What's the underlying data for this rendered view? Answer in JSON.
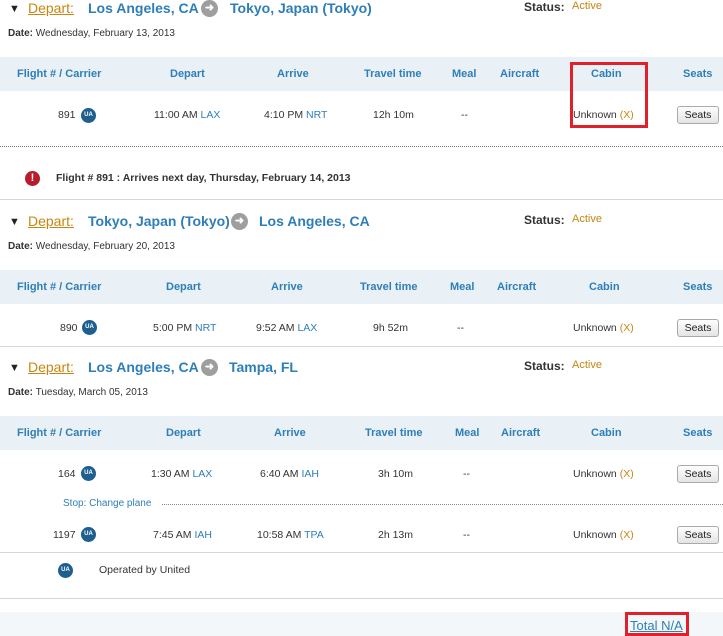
{
  "columns": [
    "Flight # / Carrier",
    "Depart",
    "Arrive",
    "Travel time",
    "Meal",
    "Aircraft",
    "Cabin",
    "Seats"
  ],
  "status_label": "Status:",
  "date_label": "Date:",
  "seats_label": "Seats",
  "trips": [
    {
      "toggle": "▼",
      "depart_label": "Depart:",
      "from": "Los Angeles, CA",
      "to": "Tokyo, Japan (Tokyo)",
      "status": "Active",
      "date": "Wednesday, February 13, 2013",
      "flights": [
        {
          "number": "891",
          "carrier": "UA",
          "depart_time": "11:00 AM",
          "depart_code": "LAX",
          "arrive_time": "4:10 PM",
          "arrive_code": "NRT",
          "travel_time": "12h 10m",
          "meal": "--",
          "aircraft": "",
          "cabin": "Unknown",
          "cabin_x": "(X)"
        }
      ],
      "alert": "Flight # 891 : Arrives next day, Thursday, February 14, 2013"
    },
    {
      "toggle": "▼",
      "depart_label": "Depart:",
      "from": "Tokyo, Japan (Tokyo)",
      "to": "Los Angeles, CA",
      "status": "Active",
      "date": "Wednesday, February 20, 2013",
      "flights": [
        {
          "number": "890",
          "carrier": "UA",
          "depart_time": "5:00 PM",
          "depart_code": "NRT",
          "arrive_time": "9:52 AM",
          "arrive_code": "LAX",
          "travel_time": "9h 52m",
          "meal": "--",
          "aircraft": "",
          "cabin": "Unknown",
          "cabin_x": "(X)"
        }
      ]
    },
    {
      "toggle": "▼",
      "depart_label": "Depart:",
      "from": "Los Angeles, CA",
      "to": "Tampa, FL",
      "status": "Active",
      "date": "Tuesday, March 05, 2013",
      "flights": [
        {
          "number": "164",
          "carrier": "UA",
          "depart_time": "1:30 AM",
          "depart_code": "LAX",
          "arrive_time": "6:40 AM",
          "arrive_code": "IAH",
          "travel_time": "3h 10m",
          "meal": "--",
          "aircraft": "",
          "cabin": "Unknown",
          "cabin_x": "(X)"
        },
        {
          "number": "1197",
          "carrier": "UA",
          "depart_time": "7:45 AM",
          "depart_code": "IAH",
          "arrive_time": "10:58 AM",
          "arrive_code": "TPA",
          "travel_time": "2h 13m",
          "meal": "--",
          "aircraft": "",
          "cabin": "Unknown",
          "cabin_x": "(X)"
        }
      ],
      "stop": "Stop: Change plane",
      "operated_by": "Operated by United",
      "operated_carrier": "UA"
    }
  ],
  "total": "Total N/A",
  "colors": {
    "link_blue": "#2e7eb8",
    "accent_orange": "#c8850f",
    "header_bg": "#eaf1f6",
    "highlight_red": "#e0202a",
    "alert_red": "#b71c2b"
  }
}
